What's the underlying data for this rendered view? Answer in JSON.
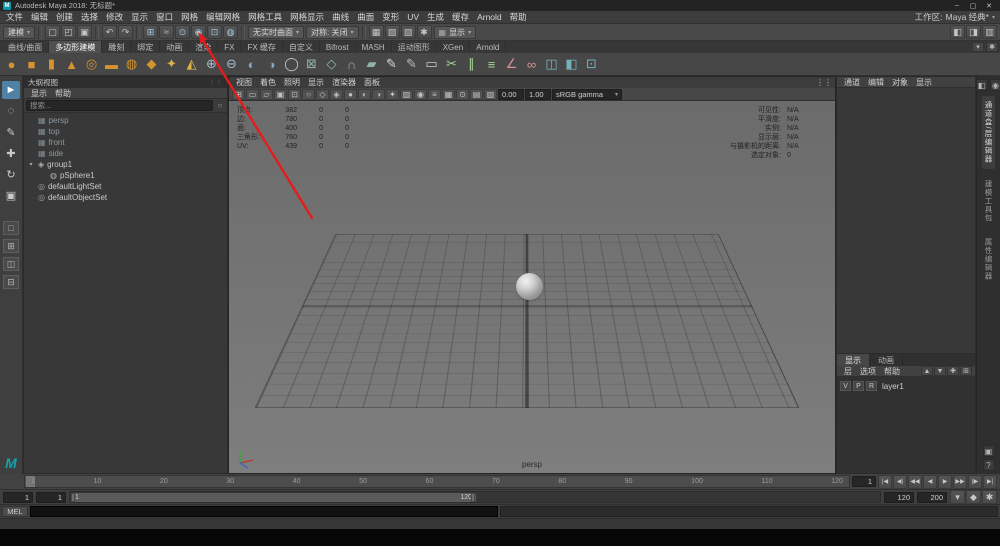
{
  "window": {
    "title": "Autodesk Maya 2018: 无标题*"
  },
  "icons": {
    "minimize": "–",
    "maximize": "▢",
    "close": "✕",
    "dropdown": "▾",
    "panel_dots": "⋮⋮",
    "search": "○"
  },
  "menubar": {
    "items": [
      "文件",
      "编辑",
      "创建",
      "选择",
      "修改",
      "显示",
      "窗口",
      "网格",
      "编辑网格",
      "网格工具",
      "网格显示",
      "曲线",
      "曲面",
      "变形",
      "UV",
      "生成",
      "缓存",
      "Arnold",
      "帮助"
    ],
    "workspace_label": "工作区:",
    "workspace_value": "Maya 经典*"
  },
  "statusline": {
    "mode": "建模",
    "file_icons": [
      {
        "n": "new-scene-icon",
        "g": "▢"
      },
      {
        "n": "open-scene-icon",
        "g": "◰"
      },
      {
        "n": "save-scene-icon",
        "g": "▣"
      }
    ],
    "history_icons": [
      {
        "n": "undo-icon",
        "g": "↶"
      },
      {
        "n": "redo-icon",
        "g": "↷"
      }
    ],
    "snap_icons": [
      {
        "n": "snap-to-grid-icon",
        "g": "⊞"
      },
      {
        "n": "snap-to-curve-icon",
        "g": "≈"
      },
      {
        "n": "snap-to-point-icon",
        "g": "⊙"
      },
      {
        "n": "snap-to-projected-center-icon",
        "g": "◉"
      },
      {
        "n": "snap-to-view-plane-icon",
        "g": "⊡"
      },
      {
        "n": "make-live-icon",
        "g": "◍"
      }
    ],
    "live_surface": "无实时曲面",
    "symmetry": "对称: 关闭",
    "render_icons": [
      {
        "n": "open-render-view-icon",
        "g": "▦"
      },
      {
        "n": "render-current-frame-icon",
        "g": "▨"
      },
      {
        "n": "ipr-render-icon",
        "g": "▧"
      },
      {
        "n": "render-settings-icon",
        "g": "✱"
      }
    ],
    "display_dropdown": "显示",
    "sidebar_icons": [
      {
        "n": "attribute-editor-toggle-icon",
        "g": "◧"
      },
      {
        "n": "tool-settings-toggle-icon",
        "g": "◨"
      },
      {
        "n": "channel-box-toggle-icon",
        "g": "▥"
      }
    ]
  },
  "shelf": {
    "tabs": [
      {
        "label": "曲线/曲面"
      },
      {
        "label": "多边形建模",
        "active": true
      },
      {
        "label": "雕刻"
      },
      {
        "label": "绑定"
      },
      {
        "label": "动画"
      },
      {
        "label": "渲染"
      },
      {
        "label": "FX"
      },
      {
        "label": "FX 缓存"
      },
      {
        "label": "自定义"
      },
      {
        "label": "Bifrost"
      },
      {
        "label": "MASH"
      },
      {
        "label": "运动图形"
      },
      {
        "label": "XGen"
      },
      {
        "label": "Arnold"
      }
    ],
    "icons": [
      {
        "n": "poly-sphere-icon",
        "g": "●",
        "c": "#d4932f"
      },
      {
        "n": "poly-cube-icon",
        "g": "■",
        "c": "#d4932f"
      },
      {
        "n": "poly-cylinder-icon",
        "g": "▮",
        "c": "#d4932f"
      },
      {
        "n": "poly-cone-icon",
        "g": "▲",
        "c": "#d4932f"
      },
      {
        "n": "poly-torus-icon",
        "g": "◎",
        "c": "#d4932f"
      },
      {
        "n": "poly-plane-icon",
        "g": "▬",
        "c": "#d4932f"
      },
      {
        "n": "poly-disc-icon",
        "g": "◍",
        "c": "#d4932f"
      },
      {
        "n": "platonic-solid-icon",
        "g": "◆",
        "c": "#d4932f"
      },
      {
        "n": "super-ellipse-icon",
        "g": "✦",
        "c": "#ddb346"
      },
      {
        "n": "sculpt-tool-icon",
        "g": "◭",
        "c": "#ddb346"
      },
      {
        "n": "combine-icon",
        "g": "⊕",
        "c": "#a8bcc9"
      },
      {
        "n": "separate-icon",
        "g": "⊖",
        "c": "#a8bcc9"
      },
      {
        "n": "boolean-union-icon",
        "g": "◐",
        "c": "#86a6c6"
      },
      {
        "n": "boolean-difference-icon",
        "g": "◑",
        "c": "#86a6c6"
      },
      {
        "n": "smooth-icon",
        "g": "◯",
        "c": "#c2cdd4"
      },
      {
        "n": "extrude-icon",
        "g": "⊠",
        "c": "#93b4a4"
      },
      {
        "n": "bevel-icon",
        "g": "◇",
        "c": "#93b4a4"
      },
      {
        "n": "bridge-icon",
        "g": "∩",
        "c": "#93b4a4"
      },
      {
        "n": "fill-hole-icon",
        "g": "▰",
        "c": "#93b4a4"
      },
      {
        "n": "append-to-polygon-icon",
        "g": "✎",
        "c": "#dcdcdc"
      },
      {
        "n": "create-polygon-icon",
        "g": "✎",
        "c": "#bcbcbc"
      },
      {
        "n": "quad-draw-icon",
        "g": "▭",
        "c": "#cccccc"
      },
      {
        "n": "multi-cut-icon",
        "g": "✂",
        "c": "#a4d494"
      },
      {
        "n": "insert-edge-loop-icon",
        "g": "∥",
        "c": "#a4d494"
      },
      {
        "n": "offset-edge-loop-icon",
        "g": "≡",
        "c": "#a4d494"
      },
      {
        "n": "crease-tool-icon",
        "g": "∠",
        "c": "#d49494"
      },
      {
        "n": "target-weld-icon",
        "g": "∞",
        "c": "#d49494"
      },
      {
        "n": "mirror-icon",
        "g": "◫",
        "c": "#72b2ba"
      },
      {
        "n": "symmetrize-icon",
        "g": "◧",
        "c": "#72b2ba"
      },
      {
        "n": "average-vertices-icon",
        "g": "⊡",
        "c": "#72b2ba"
      }
    ]
  },
  "toolbox": {
    "tools": [
      {
        "n": "select-tool",
        "g": "►",
        "active": true
      },
      {
        "n": "lasso-tool",
        "g": "◌"
      },
      {
        "n": "paint-select-tool",
        "g": "✎"
      },
      {
        "n": "move-tool",
        "g": "✚"
      },
      {
        "n": "rotate-tool",
        "g": "↻"
      },
      {
        "n": "scale-tool",
        "g": "▣"
      }
    ],
    "layouts": [
      {
        "n": "layout-single-pane",
        "g": "□"
      },
      {
        "n": "layout-four-pane",
        "g": "⊞"
      },
      {
        "n": "layout-persp-outliner",
        "g": "◫"
      },
      {
        "n": "layout-persp-graph",
        "g": "⊟"
      }
    ]
  },
  "outliner": {
    "title": "大纲视图",
    "menus": [
      "显示",
      "帮助"
    ],
    "search_placeholder": "搜索...",
    "items": [
      {
        "label": "persp",
        "cls": "camera",
        "g": "▦"
      },
      {
        "label": "top",
        "cls": "camera",
        "g": "▦"
      },
      {
        "label": "front",
        "cls": "camera",
        "g": "▦"
      },
      {
        "label": "side",
        "cls": "camera",
        "g": "▦"
      },
      {
        "label": "group1",
        "cls": "group",
        "g": "◈",
        "exp": "▾"
      },
      {
        "label": "pSphere1",
        "cls": "mesh",
        "g": "◍",
        "indent": 1
      },
      {
        "label": "defaultLightSet",
        "cls": "set",
        "g": "◎"
      },
      {
        "label": "defaultObjectSet",
        "cls": "set",
        "g": "◎"
      }
    ]
  },
  "viewport": {
    "menus": [
      "视图",
      "着色",
      "照明",
      "显示",
      "渲染器",
      "面板"
    ],
    "toolbar_icons": [
      {
        "n": "grid-toggle-icon",
        "g": "⊞"
      },
      {
        "n": "film-gate-icon",
        "g": "▭"
      },
      {
        "n": "resolution-gate-icon",
        "g": "▱"
      },
      {
        "n": "gate-mask-icon",
        "g": "▣"
      },
      {
        "n": "field-chart-icon",
        "g": "⊡"
      },
      {
        "n": "safe-action-icon",
        "g": "○"
      },
      {
        "n": "safe-title-icon",
        "g": "◇"
      },
      {
        "n": "wireframe-icon",
        "g": "◈"
      },
      {
        "n": "shaded-icon",
        "g": "●"
      },
      {
        "n": "textured-icon",
        "g": "◐"
      },
      {
        "n": "use-default-material-icon",
        "g": "◑"
      },
      {
        "n": "lighting-icon",
        "g": "✦"
      },
      {
        "n": "shadows-icon",
        "g": "▨"
      },
      {
        "n": "ambient-occlusion-icon",
        "g": "◉"
      },
      {
        "n": "motion-blur-icon",
        "g": "≡"
      },
      {
        "n": "multisample-icon",
        "g": "▦"
      },
      {
        "n": "depth-of-field-icon",
        "g": "⊙"
      },
      {
        "n": "isolate-select-icon",
        "g": "▤"
      },
      {
        "n": "xray-icon",
        "g": "▧"
      }
    ],
    "exposure": "0.00",
    "gamma": "1.00",
    "colorspace": "sRGB gamma",
    "camera_label": "persp",
    "hud_left": [
      {
        "label": "顶点:",
        "v1": "382",
        "v2": "0",
        "v3": "0"
      },
      {
        "label": "边:",
        "v1": "780",
        "v2": "0",
        "v3": "0"
      },
      {
        "label": "面:",
        "v1": "400",
        "v2": "0",
        "v3": "0"
      },
      {
        "label": "三角形:",
        "v1": "760",
        "v2": "0",
        "v3": "0"
      },
      {
        "label": "UV:",
        "v1": "439",
        "v2": "0",
        "v3": "0"
      }
    ],
    "hud_right": [
      {
        "label": "可见性:",
        "value": "N/A"
      },
      {
        "label": "平滑度:",
        "value": "N/A"
      },
      {
        "label": "实例:",
        "value": "N/A"
      },
      {
        "label": "显示层:",
        "value": "N/A"
      },
      {
        "label": "与摄影机的距离:",
        "value": "N/A"
      },
      {
        "label": "选定对象:",
        "value": "0"
      }
    ]
  },
  "channelbox": {
    "menus": [
      "通道",
      "编辑",
      "对象",
      "显示"
    ]
  },
  "right_strip": {
    "top_icons": [
      {
        "n": "expand-panel-icon",
        "g": "◧"
      },
      {
        "n": "pin-panel-icon",
        "g": "◉"
      }
    ],
    "tabs": [
      {
        "label": "通道盒/层编辑器",
        "active": true
      },
      {
        "label": "建模工具包"
      },
      {
        "label": "属性编辑器"
      }
    ],
    "bottom_icons": [
      {
        "n": "screen-capture-icon",
        "g": "▣"
      },
      {
        "n": "help-panel-icon",
        "g": "?"
      }
    ]
  },
  "layer_editor": {
    "tabs": [
      {
        "label": "显示",
        "active": true
      },
      {
        "label": "动画"
      }
    ],
    "menus": [
      "层",
      "选项",
      "帮助"
    ],
    "toolbar_icons": [
      {
        "n": "move-layer-up-icon",
        "g": "▲"
      },
      {
        "n": "move-layer-down-icon",
        "g": "▼"
      },
      {
        "n": "new-empty-layer-icon",
        "g": "✚"
      },
      {
        "n": "new-layer-from-selected-icon",
        "g": "⊞"
      }
    ],
    "layer": {
      "toggles": [
        "V",
        "P",
        "R"
      ],
      "name": "layer1"
    }
  },
  "timeline": {
    "ticks": [
      "1",
      "10",
      "20",
      "30",
      "40",
      "50",
      "60",
      "70",
      "80",
      "90",
      "100",
      "110",
      "120"
    ],
    "current_frame": "1",
    "transport": [
      {
        "n": "go-to-range-start-icon",
        "g": "|◀"
      },
      {
        "n": "step-back-frame-icon",
        "g": "◀|"
      },
      {
        "n": "step-back-key-icon",
        "g": "◀◀"
      },
      {
        "n": "play-backwards-icon",
        "g": "◀"
      },
      {
        "n": "play-forwards-icon",
        "g": "▶"
      },
      {
        "n": "step-forward-key-icon",
        "g": "▶▶"
      },
      {
        "n": "step-forward-frame-icon",
        "g": "|▶"
      },
      {
        "n": "go-to-range-end-icon",
        "g": "▶|"
      }
    ]
  },
  "range_slider": {
    "anim_start": "1",
    "playback_start": "1",
    "bar_start_label": "1",
    "bar_end_label": "120",
    "playback_end": "120",
    "anim_end": "200",
    "right_icons": [
      {
        "n": "character-set-menu-icon",
        "g": "▾"
      },
      {
        "n": "auto-keyframe-icon",
        "g": "◆"
      },
      {
        "n": "animation-preferences-icon",
        "g": "✱"
      }
    ]
  },
  "command_line": {
    "label": "MEL"
  }
}
